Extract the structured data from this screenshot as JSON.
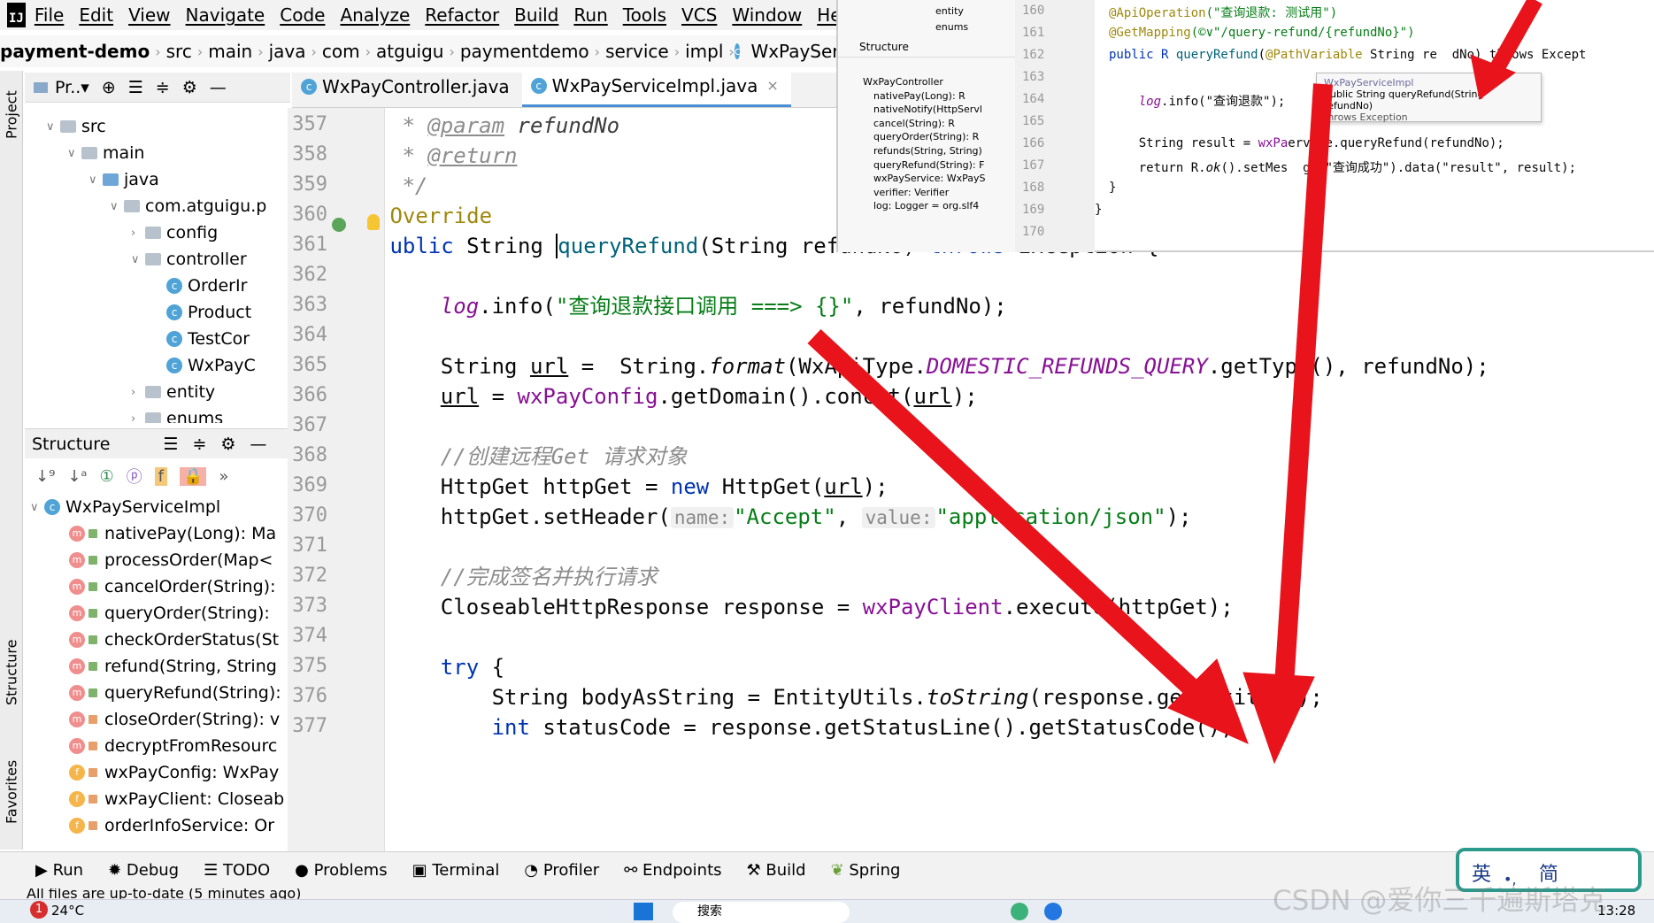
{
  "menu": [
    "File",
    "Edit",
    "View",
    "Navigate",
    "Code",
    "Analyze",
    "Refactor",
    "Build",
    "Run",
    "Tools",
    "VCS",
    "Window",
    "Help"
  ],
  "breadcrumb": [
    "payment-demo",
    "src",
    "main",
    "java",
    "com",
    "atguigu",
    "paymentdemo",
    "service",
    "impl",
    "WxPayServiceImpl"
  ],
  "project_panel": {
    "title": "Pr..▾",
    "tab_label": "Project"
  },
  "project_tree": [
    {
      "label": "src",
      "depth": 1,
      "kind": "folder"
    },
    {
      "label": "main",
      "depth": 2,
      "kind": "folder"
    },
    {
      "label": "java",
      "depth": 3,
      "kind": "folder-blue"
    },
    {
      "label": "com.atguigu.p",
      "depth": 4,
      "kind": "folder"
    },
    {
      "label": "config",
      "depth": 5,
      "kind": "folder"
    },
    {
      "label": "controller",
      "depth": 5,
      "kind": "folder"
    },
    {
      "label": "OrderIr",
      "depth": 6,
      "kind": "class"
    },
    {
      "label": "Product",
      "depth": 6,
      "kind": "class"
    },
    {
      "label": "TestCor",
      "depth": 6,
      "kind": "class"
    },
    {
      "label": "WxPayC",
      "depth": 6,
      "kind": "class"
    },
    {
      "label": "entity",
      "depth": 5,
      "kind": "folder"
    },
    {
      "label": "enums",
      "depth": 5,
      "kind": "folder"
    }
  ],
  "structure_panel": {
    "title": "Structure",
    "root": "WxPayServiceImpl",
    "items": [
      {
        "label": "nativePay(Long): Ma",
        "kind": "m"
      },
      {
        "label": "processOrder(Map<",
        "kind": "m"
      },
      {
        "label": "cancelOrder(String):",
        "kind": "m"
      },
      {
        "label": "queryOrder(String):",
        "kind": "m"
      },
      {
        "label": "checkOrderStatus(St",
        "kind": "m"
      },
      {
        "label": "refund(String, String",
        "kind": "m"
      },
      {
        "label": "queryRefund(String):",
        "kind": "m"
      },
      {
        "label": "closeOrder(String): v",
        "kind": "m-private"
      },
      {
        "label": "decryptFromResourc",
        "kind": "m-private"
      },
      {
        "label": "wxPayConfig: WxPay",
        "kind": "f-private"
      },
      {
        "label": "wxPayClient: Closeab",
        "kind": "f-private"
      },
      {
        "label": "orderInfoService: Or",
        "kind": "f-private"
      }
    ]
  },
  "editor_tabs": [
    {
      "label": "WxPayController.java",
      "active": false
    },
    {
      "label": "WxPayServiceImpl.java",
      "active": true
    }
  ],
  "line_numbers": [
    "357",
    "358",
    "359",
    "360",
    "361",
    "362",
    "363",
    "364",
    "365",
    "366",
    "367",
    "368",
    "369",
    "370",
    "371",
    "372",
    "373",
    "374",
    "375",
    "376",
    "377"
  ],
  "code": {
    "l357_a": " * ",
    "l357_tag": "@param",
    "l357_b": " ",
    "l357_p": "refundNo",
    "l358_a": " * ",
    "l358_tag": "@return",
    "l359": " */",
    "l360": "@Override",
    "l361_kw": "public",
    "l361_a": " String ",
    "l361_fn": "queryRefund",
    "l361_b": "(String refundNo) ",
    "l361_kw2": "throws",
    "l361_c": " Exception {",
    "l363_a": "    ",
    "l363_log": "log",
    "l363_b": ".info(",
    "l363_str": "\"查询退款接口调用 ===> {}\"",
    "l363_c": ", refundNo);",
    "l365_a": "    String ",
    "l365_url": "url",
    "l365_b": " =  String.",
    "l365_fmt": "format",
    "l365_c": "(WxApiType.",
    "l365_const": "DOMESTIC_REFUNDS_QUERY",
    "l365_d": ".getType(), refundNo);",
    "l366_url": "url",
    "l366_a": " = ",
    "l366_cfg": "wxPayConfig",
    "l366_b": ".getDomain().concat(",
    "l366_url2": "url",
    "l366_c": ");",
    "l368": "    //创建远程Get 请求对象",
    "l369_a": "    HttpGet httpGet = ",
    "l369_kw": "new",
    "l369_b": " HttpGet(",
    "l369_url": "url",
    "l369_c": ");",
    "l370_a": "    httpGet.setHeader(",
    "l370_h1": "name:",
    "l370_s1": "\"Accept\"",
    "l370_b": ", ",
    "l370_h2": "value:",
    "l370_s2": "\"application/json\"",
    "l370_c": ");",
    "l372": "    //完成签名并执行请求",
    "l373_a": "    CloseableHttpResponse response = ",
    "l373_cli": "wxPayClient",
    "l373_b": ".execute(httpGet);",
    "l375_a": "    ",
    "l375_kw": "try",
    "l375_b": " {",
    "l376_a": "        String bodyAsString = EntityUtils.",
    "l376_fn": "toString",
    "l376_b": "(response.getEntity());",
    "l377_a": "        ",
    "l377_kw": "int",
    "l377_b": " statusCode = response.getStatusLine().getStatusCode();"
  },
  "overlay": {
    "tree_items": [
      "entity",
      "enums"
    ],
    "structure_title": "Structure",
    "struct_items": [
      "WxPayController",
      "nativePay(Long): R",
      "nativeNotify(HttpServl",
      "cancel(String): R",
      "queryOrder(String): R",
      "refunds(String, String)",
      "queryRefund(String): F",
      "wxPayService: WxPayS",
      "verifier: Verifier",
      "log: Logger = org.slf4"
    ],
    "line_numbers": [
      "160",
      "161",
      "162",
      "163",
      "164",
      "165",
      "166",
      "167",
      "168",
      "169",
      "170"
    ],
    "l160_an": "@ApiOperation",
    "l160_s": "(\"查询退款: 测试用\")",
    "l161_an": "@GetMapping",
    "l161_s": "(©∨\"/query-refund/{refundNo}\")",
    "l162_a": "public R ",
    "l162_fn": "queryRefund",
    "l162_b": "(",
    "l162_an": "@PathVariable",
    "l162_c": " String re  dNo) throws Except",
    "l164_a": "    ",
    "l164_log": "log",
    "l164_b": ".info(\"查询退款\");",
    "l166_a": "    String result = ",
    "l166_svc": "wxPa",
    "l166_b": "ervice.queryRefund(refundNo);",
    "l167_a": "    return R.",
    "l167_ok": "ok",
    "l167_b": "().setMes  ge(\"查询成功\").data(\"result\", result);",
    "l168": "}",
    "l169": "}",
    "tooltip_title": "WxPayServiceImpl",
    "tooltip_sig": "public String queryRefund(String refundNo)",
    "tooltip_throws": "throws Exception"
  },
  "bottom_tools": [
    "Run",
    "Debug",
    "TODO",
    "Problems",
    "Terminal",
    "Profiler",
    "Endpoints",
    "Build",
    "Spring"
  ],
  "status_text": "All files are up-to-date (5 minutes ago)",
  "taskbar": {
    "weather": "24°C",
    "time": "13:28",
    "badge": "1",
    "search": "搜索"
  },
  "ime": {
    "label1": "英",
    "label2": "简"
  },
  "watermark": "CSDN @爱你三千遍斯塔克",
  "colors": {
    "arrow": "#e8131b",
    "accent": "#4a8fd6",
    "keyword": "#0033b3",
    "string": "#067d17"
  }
}
